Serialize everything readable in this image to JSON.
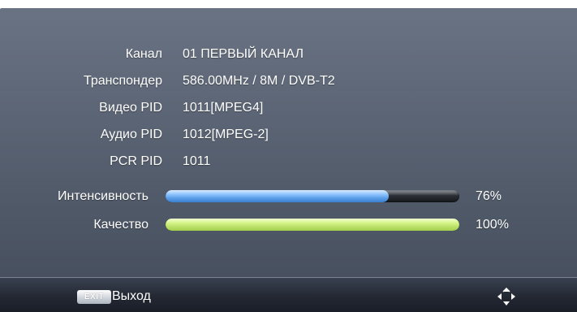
{
  "info": {
    "channel": {
      "label": "Канал",
      "value": "01 ПЕРВЫЙ КАНАЛ"
    },
    "transponder": {
      "label": "Транспондер",
      "value": "586.00MHz / 8M / DVB-T2"
    },
    "video_pid": {
      "label": "Видео PID",
      "value": "1011[MPEG4]"
    },
    "audio_pid": {
      "label": "Аудио PID",
      "value": "1012[MPEG-2]"
    },
    "pcr_pid": {
      "label": "PCR PID",
      "value": "1011"
    }
  },
  "signal": {
    "intensity": {
      "label": "Интенсивность",
      "percent_text": "76%",
      "value": 0.76
    },
    "quality": {
      "label": "Качество",
      "percent_text": "100%",
      "value": 1.0
    }
  },
  "footer": {
    "exit_key": "EXIT",
    "exit_label": "Выход",
    "nav_icon": "navigation-arrows-icon"
  },
  "colors": {
    "intensity_bar": "#5c9fe8",
    "quality_bar": "#bde26a",
    "panel_background": "#5c6575"
  }
}
